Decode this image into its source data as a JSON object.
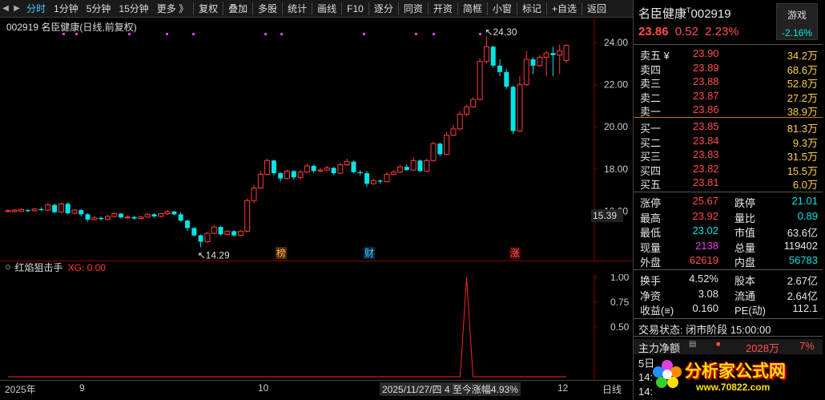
{
  "toolbar": {
    "tabs": [
      "分时",
      "1分钟",
      "5分钟",
      "15分钟",
      "更多 》"
    ],
    "buttons": [
      "复权",
      "叠加",
      "多股",
      "统计",
      "画线",
      "F10",
      "逐分",
      "同资",
      "开资",
      "简框",
      "小窗",
      "标记",
      "+自选",
      "返回"
    ]
  },
  "chart": {
    "title": "002919 名臣健康(日线,前复权)",
    "price_axis": [
      "24.00",
      "22.00",
      "20.00",
      "18.00",
      "16.00"
    ],
    "current_price_tag": "15.39",
    "high_label": "24.30",
    "low_label": "14.29",
    "markers": [
      "榜",
      "财",
      "涨"
    ]
  },
  "indicator": {
    "name": "红焰狙击手",
    "value_label": "XG: 0.00",
    "axis": [
      "1.00",
      "0.75",
      "0.50"
    ]
  },
  "bottom": {
    "labels": [
      "2025年",
      "9",
      "10",
      "12"
    ],
    "cursor_info": "2025/11/27/四 4 至今涨幅4.93%",
    "period": "日线"
  },
  "colors": {
    "up": "#ff3b3b",
    "down": "#00e5e5",
    "accent": "#4ac8ff"
  },
  "chart_data": {
    "type": "candlestick",
    "xlabel": "",
    "ylabel": "",
    "ylim": [
      15.2,
      24.8
    ],
    "x_labels": [
      "9",
      "10",
      "12"
    ],
    "candles": [
      {
        "o": 16.0,
        "c": 16.02,
        "h": 16.08,
        "l": 15.95
      },
      {
        "o": 15.98,
        "c": 16.05,
        "h": 16.1,
        "l": 15.93
      },
      {
        "o": 16.0,
        "c": 16.08,
        "h": 16.13,
        "l": 15.97
      },
      {
        "o": 16.05,
        "c": 16.0,
        "h": 16.1,
        "l": 15.95
      },
      {
        "o": 16.02,
        "c": 16.1,
        "h": 16.15,
        "l": 15.98
      },
      {
        "o": 16.1,
        "c": 16.05,
        "h": 16.18,
        "l": 16.0
      },
      {
        "o": 16.05,
        "c": 16.3,
        "h": 16.38,
        "l": 16.0
      },
      {
        "o": 16.3,
        "c": 15.95,
        "h": 16.35,
        "l": 15.9
      },
      {
        "o": 15.95,
        "c": 16.35,
        "h": 16.4,
        "l": 15.9
      },
      {
        "o": 16.35,
        "c": 15.9,
        "h": 16.42,
        "l": 15.85
      },
      {
        "o": 15.9,
        "c": 16.05,
        "h": 16.1,
        "l": 15.85
      },
      {
        "o": 16.05,
        "c": 15.85,
        "h": 16.1,
        "l": 15.75
      },
      {
        "o": 15.85,
        "c": 15.6,
        "h": 15.9,
        "l": 15.5
      },
      {
        "o": 15.6,
        "c": 15.68,
        "h": 15.78,
        "l": 15.55
      },
      {
        "o": 15.68,
        "c": 15.62,
        "h": 15.75,
        "l": 15.55
      },
      {
        "o": 15.62,
        "c": 15.75,
        "h": 15.82,
        "l": 15.58
      },
      {
        "o": 15.75,
        "c": 15.88,
        "h": 15.95,
        "l": 15.7
      },
      {
        "o": 15.88,
        "c": 15.7,
        "h": 15.92,
        "l": 15.65
      },
      {
        "o": 15.7,
        "c": 15.72,
        "h": 15.8,
        "l": 15.65
      },
      {
        "o": 15.72,
        "c": 15.65,
        "h": 15.78,
        "l": 15.6
      },
      {
        "o": 15.65,
        "c": 15.72,
        "h": 15.78,
        "l": 15.6
      },
      {
        "o": 15.72,
        "c": 15.85,
        "h": 15.9,
        "l": 15.68
      },
      {
        "o": 15.85,
        "c": 15.75,
        "h": 15.9,
        "l": 15.7
      },
      {
        "o": 15.75,
        "c": 15.88,
        "h": 15.92,
        "l": 15.7
      },
      {
        "o": 15.88,
        "c": 15.98,
        "h": 16.05,
        "l": 15.82
      },
      {
        "o": 15.98,
        "c": 15.85,
        "h": 16.02,
        "l": 15.8
      },
      {
        "o": 15.85,
        "c": 15.55,
        "h": 15.95,
        "l": 15.5
      },
      {
        "o": 15.55,
        "c": 15.2,
        "h": 15.6,
        "l": 15.05
      },
      {
        "o": 15.2,
        "c": 14.85,
        "h": 15.25,
        "l": 14.8
      },
      {
        "o": 14.85,
        "c": 14.55,
        "h": 14.9,
        "l": 14.29
      },
      {
        "o": 14.55,
        "c": 14.95,
        "h": 15.0,
        "l": 14.5
      },
      {
        "o": 14.95,
        "c": 15.25,
        "h": 15.35,
        "l": 14.9
      },
      {
        "o": 15.25,
        "c": 14.9,
        "h": 15.3,
        "l": 14.85
      },
      {
        "o": 14.9,
        "c": 15.05,
        "h": 15.1,
        "l": 14.85
      },
      {
        "o": 15.05,
        "c": 14.85,
        "h": 15.1,
        "l": 14.8
      },
      {
        "o": 14.85,
        "c": 15.05,
        "h": 15.1,
        "l": 14.8
      },
      {
        "o": 15.05,
        "c": 16.5,
        "h": 16.6,
        "l": 15.0
      },
      {
        "o": 16.5,
        "c": 17.1,
        "h": 17.25,
        "l": 16.4
      },
      {
        "o": 17.1,
        "c": 17.75,
        "h": 17.9,
        "l": 17.05
      },
      {
        "o": 17.75,
        "c": 18.4,
        "h": 18.5,
        "l": 17.7
      },
      {
        "o": 18.4,
        "c": 17.8,
        "h": 18.45,
        "l": 17.7
      },
      {
        "o": 17.8,
        "c": 17.55,
        "h": 17.85,
        "l": 17.4
      },
      {
        "o": 17.55,
        "c": 17.9,
        "h": 17.95,
        "l": 17.5
      },
      {
        "o": 17.9,
        "c": 17.6,
        "h": 17.95,
        "l": 17.5
      },
      {
        "o": 17.6,
        "c": 17.85,
        "h": 17.95,
        "l": 17.5
      },
      {
        "o": 17.85,
        "c": 18.15,
        "h": 18.25,
        "l": 17.8
      },
      {
        "o": 18.15,
        "c": 17.9,
        "h": 18.2,
        "l": 17.8
      },
      {
        "o": 17.9,
        "c": 17.95,
        "h": 18.05,
        "l": 17.85
      },
      {
        "o": 17.95,
        "c": 18.05,
        "h": 18.15,
        "l": 17.9
      },
      {
        "o": 18.05,
        "c": 17.8,
        "h": 18.1,
        "l": 17.7
      },
      {
        "o": 17.8,
        "c": 18.2,
        "h": 18.3,
        "l": 17.75
      },
      {
        "o": 18.2,
        "c": 18.35,
        "h": 18.5,
        "l": 18.15
      },
      {
        "o": 18.35,
        "c": 17.85,
        "h": 18.4,
        "l": 17.8
      },
      {
        "o": 17.85,
        "c": 17.8,
        "h": 17.95,
        "l": 17.7
      },
      {
        "o": 17.8,
        "c": 17.3,
        "h": 17.9,
        "l": 17.15
      },
      {
        "o": 17.3,
        "c": 17.45,
        "h": 17.55,
        "l": 17.25
      },
      {
        "o": 17.45,
        "c": 17.4,
        "h": 17.5,
        "l": 17.3
      },
      {
        "o": 17.4,
        "c": 17.75,
        "h": 17.85,
        "l": 17.35
      },
      {
        "o": 17.75,
        "c": 17.85,
        "h": 17.95,
        "l": 17.7
      },
      {
        "o": 17.85,
        "c": 18.1,
        "h": 18.2,
        "l": 17.8
      },
      {
        "o": 18.1,
        "c": 17.95,
        "h": 18.2,
        "l": 17.9
      },
      {
        "o": 17.95,
        "c": 18.4,
        "h": 18.55,
        "l": 17.9
      },
      {
        "o": 18.4,
        "c": 17.9,
        "h": 18.45,
        "l": 17.85
      },
      {
        "o": 17.9,
        "c": 18.4,
        "h": 18.5,
        "l": 17.85
      },
      {
        "o": 18.4,
        "c": 19.2,
        "h": 19.3,
        "l": 18.35
      },
      {
        "o": 19.2,
        "c": 18.7,
        "h": 19.25,
        "l": 18.6
      },
      {
        "o": 18.7,
        "c": 19.6,
        "h": 19.75,
        "l": 18.65
      },
      {
        "o": 19.6,
        "c": 19.9,
        "h": 20.1,
        "l": 19.55
      },
      {
        "o": 19.9,
        "c": 20.6,
        "h": 20.75,
        "l": 19.85
      },
      {
        "o": 20.6,
        "c": 20.95,
        "h": 21.05,
        "l": 20.5
      },
      {
        "o": 20.95,
        "c": 21.3,
        "h": 21.4,
        "l": 20.9
      },
      {
        "o": 21.3,
        "c": 23.1,
        "h": 23.25,
        "l": 21.25
      },
      {
        "o": 23.1,
        "c": 23.8,
        "h": 24.3,
        "l": 23.0
      },
      {
        "o": 23.8,
        "c": 22.9,
        "h": 23.85,
        "l": 22.8
      },
      {
        "o": 22.9,
        "c": 22.6,
        "h": 23.2,
        "l": 22.4
      },
      {
        "o": 22.6,
        "c": 21.9,
        "h": 22.75,
        "l": 21.8
      },
      {
        "o": 21.9,
        "c": 19.8,
        "h": 21.95,
        "l": 19.65
      },
      {
        "o": 19.8,
        "c": 22.0,
        "h": 22.4,
        "l": 19.75
      },
      {
        "o": 22.0,
        "c": 23.2,
        "h": 23.6,
        "l": 21.95
      },
      {
        "o": 23.2,
        "c": 22.9,
        "h": 23.3,
        "l": 22.5
      },
      {
        "o": 22.9,
        "c": 23.3,
        "h": 23.4,
        "l": 22.85
      },
      {
        "o": 23.3,
        "c": 23.5,
        "h": 23.6,
        "l": 22.4
      },
      {
        "o": 23.5,
        "c": 23.4,
        "h": 23.8,
        "l": 22.4
      },
      {
        "o": 23.4,
        "c": 23.6,
        "h": 23.9,
        "l": 22.5
      },
      {
        "o": 23.15,
        "c": 23.86,
        "h": 23.92,
        "l": 23.02
      }
    ],
    "indicator_series": {
      "name": "XG",
      "ylim": [
        0,
        1
      ],
      "spike_index": 69,
      "spike_value": 1.0
    }
  },
  "quote": {
    "name": "名臣健康",
    "superscript": "T",
    "code": "002919",
    "price": "23.86",
    "change": "0.52",
    "change_pct": "2.23%",
    "side_tag": "游戏",
    "side_pct": "-2.16%",
    "asks": [
      {
        "label": "卖五 ¥",
        "price": "23.90",
        "vol": "34.2万"
      },
      {
        "label": "卖四",
        "price": "23.89",
        "vol": "68.6万"
      },
      {
        "label": "卖三",
        "price": "23.88",
        "vol": "52.8万"
      },
      {
        "label": "卖二",
        "price": "23.87",
        "vol": "27.2万"
      },
      {
        "label": "卖一",
        "price": "23.86",
        "vol": "38.9万"
      }
    ],
    "bids": [
      {
        "label": "买一",
        "price": "23.85",
        "vol": "81.3万"
      },
      {
        "label": "买二",
        "price": "23.84",
        "vol": "9.3万"
      },
      {
        "label": "买三",
        "price": "23.83",
        "vol": "31.5万"
      },
      {
        "label": "买四",
        "price": "23.82",
        "vol": "15.5万"
      },
      {
        "label": "买五",
        "price": "23.81",
        "vol": "6.0万"
      }
    ],
    "stats1": [
      {
        "l1": "涨停",
        "v1": "25.67",
        "l2": "跌停",
        "v2": "21.01"
      },
      {
        "l1": "最高",
        "v1": "23.92",
        "l2": "量比",
        "v2": "0.89"
      },
      {
        "l1": "最低",
        "v1": "23.02",
        "l2": "市值",
        "v2": "63.6亿"
      },
      {
        "l1": "现量",
        "v1": "2138",
        "l2": "总量",
        "v2": "119402"
      },
      {
        "l1": "外盘",
        "v1": "62619",
        "l2": "内盘",
        "v2": "56783"
      }
    ],
    "stats2": [
      {
        "l1": "换手",
        "v1": "4.52%",
        "l2": "股本",
        "v2": "2.67亿"
      },
      {
        "l1": "净资",
        "v1": "3.08",
        "l2": "流通",
        "v2": "2.64亿"
      },
      {
        "l1": "收益(≡)",
        "v1": "0.160",
        "l2": "PE(动)",
        "v2": "112.1"
      }
    ],
    "trade_status": "交易状态: 闭市阶段 15:00:00",
    "main_flow_label": "主力净额",
    "main_flow_value": "2028万",
    "main_flow_pct": "7%",
    "period_label": "5日",
    "time_peek": "14:",
    "time_peek2": "14:"
  },
  "watermark": {
    "brand": "分析家公式网",
    "url": "www.70822.com"
  }
}
